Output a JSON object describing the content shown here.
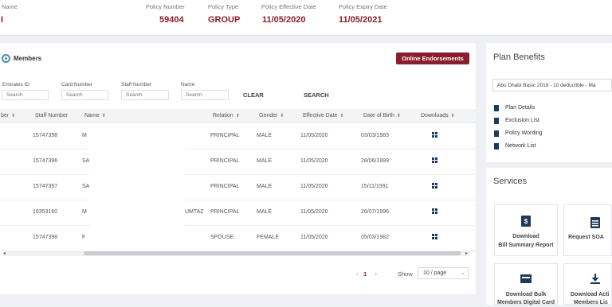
{
  "header": {
    "name_label": "Name",
    "name_value": "I",
    "policy_number_label": "Policy Number",
    "policy_number_value": "59404",
    "policy_type_label": "Policy Type",
    "policy_type_value": "GROUP",
    "eff_label": "Policy Effective Date",
    "eff_value": "11/05/2020",
    "exp_label": "Policy Expiry Date",
    "exp_value": "11/05/2021"
  },
  "members": {
    "title": "Members",
    "online_endorsements": "Online Endorsements",
    "filters": [
      {
        "label": "Emirates ID",
        "placeholder": "Search"
      },
      {
        "label": "Card Number",
        "placeholder": "Search"
      },
      {
        "label": "Staff Number",
        "placeholder": "Search"
      },
      {
        "label": "Name",
        "placeholder": "Search"
      }
    ],
    "clear": "CLEAR",
    "search": "SEARCH",
    "columns": [
      "ber",
      "Staff Number",
      "Name",
      "Relation",
      "Gender",
      "Effective Date",
      "Date of Birth",
      "Downloads"
    ],
    "rows": [
      {
        "staff": "15747398",
        "name": "M",
        "relation": "PRINCIPAL",
        "gender": "MALE",
        "eff": "11/05/2020",
        "dob": "03/03/1983"
      },
      {
        "staff": "15747396",
        "name": "SA",
        "relation": "PRINCIPAL",
        "gender": "MALE",
        "eff": "11/05/2020",
        "dob": "28/06/1999"
      },
      {
        "staff": "15747397",
        "name": "SA",
        "relation": "PRINCIPAL",
        "gender": "MALE",
        "eff": "11/05/2020",
        "dob": "15/11/1991"
      },
      {
        "staff": "16353160",
        "name": "M",
        "name_tail": "UMTAZ",
        "relation": "PRINCIPAL",
        "gender": "MALE",
        "eff": "11/05/2020",
        "dob": "26/07/1996"
      },
      {
        "staff": "15747398",
        "name": "F",
        "relation": "SPOUSE",
        "gender": "FEMALE",
        "eff": "11/05/2020",
        "dob": "05/03/1982"
      }
    ],
    "pagination": {
      "page": "1",
      "show_label": "Show",
      "page_size": "10 / page"
    }
  },
  "plan_benefits": {
    "title": "Plan Benefits",
    "selected_plan": "Abu Dhabi Basic 2019 - 10 deductible - Ma",
    "items": [
      "Plan Details",
      "Exclusion List",
      "Policy Wording",
      "Network List"
    ]
  },
  "services": {
    "title": "Services",
    "cards": [
      {
        "line1": "Download",
        "line2": "Bill Summary Report"
      },
      {
        "line1": "Request SOA",
        "line2": ""
      },
      {
        "line1": "Download Bulk",
        "line2": "Members Digital Card"
      },
      {
        "line1": "Download Acti",
        "line2": "Members Lis"
      }
    ]
  },
  "colors": {
    "brand": "#8b1e2d",
    "navy": "#1e3a5a",
    "accent": "#4a8fb0"
  }
}
